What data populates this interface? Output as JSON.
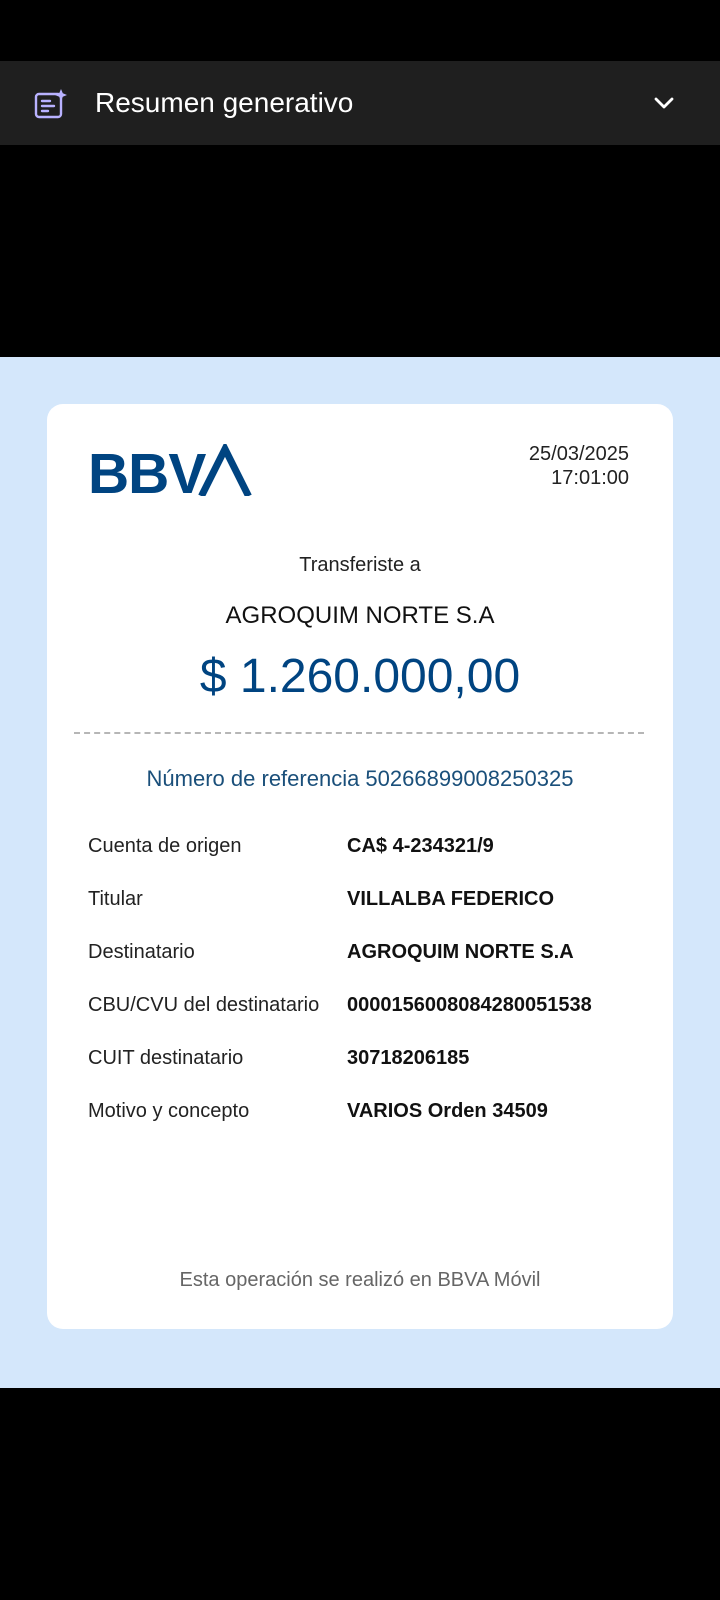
{
  "viewer": {
    "summary_title": "Resumen generativo",
    "icons": {
      "summary": "ai-summary-icon",
      "toggle": "chevron-down-icon"
    }
  },
  "receipt": {
    "bank": "BBVA",
    "date": "25/03/2025",
    "time": "17:01:00",
    "transfer_label": "Transferiste a",
    "recipient": "AGROQUIM NORTE S.A",
    "amount": "$ 1.260.000,00",
    "reference": "Número de referencia 50266899008250325",
    "details": [
      {
        "label": "Cuenta de origen",
        "value": "CA$ 4-234321/9"
      },
      {
        "label": "Titular",
        "value": "VILLALBA FEDERICO"
      },
      {
        "label": "Destinatario",
        "value": "AGROQUIM NORTE S.A"
      },
      {
        "label": "CBU/CVU del destinatario",
        "value": "0000156008084280051538"
      },
      {
        "label": "CUIT destinatario",
        "value": "30718206185"
      },
      {
        "label": "Motivo y concepto",
        "value": "VARIOS Orden 34509"
      }
    ],
    "footer": "Esta operación se realizó en BBVA Móvil"
  },
  "colors": {
    "brand_blue": "#004481",
    "background_blue": "#d4e7fb",
    "summary_bar": "#1f1f1f",
    "icon_lavender": "#b9b2ff"
  }
}
